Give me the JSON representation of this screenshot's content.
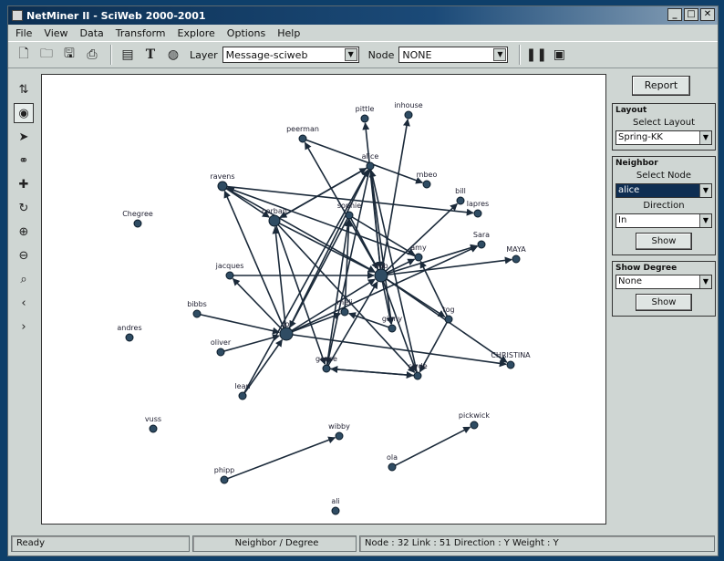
{
  "window": {
    "title": "NetMiner II - SciWeb 2000-2001"
  },
  "window_controls": [
    "_",
    "□",
    "✕"
  ],
  "menu": [
    "File",
    "View",
    "Data",
    "Transform",
    "Explore",
    "Options",
    "Help"
  ],
  "toolbar": {
    "layer_label": "Layer",
    "layer_value": "Message-sciweb",
    "node_label": "Node",
    "node_value": "NONE"
  },
  "right_panel": {
    "report_label": "Report",
    "layout": {
      "title": "Layout",
      "select_label": "Select Layout",
      "value": "Spring-KK"
    },
    "neighbor": {
      "title": "Neighbor",
      "select_node_label": "Select Node",
      "node_value": "alice",
      "direction_label": "Direction",
      "direction_value": "In",
      "show_label": "Show"
    },
    "show_degree": {
      "title": "Show Degree",
      "value": "None",
      "show_label": "Show"
    }
  },
  "status": {
    "ready": "Ready",
    "mode": "Neighbor / Degree",
    "info": "Node : 32   Link : 51   Direction : Y   Weight : Y"
  },
  "graph": {
    "nodes": [
      {
        "id": "pittle",
        "label": "pittle"
      },
      {
        "id": "inhouse",
        "label": "inhouse"
      },
      {
        "id": "peerman",
        "label": "peerman"
      },
      {
        "id": "alice",
        "label": "alice"
      },
      {
        "id": "mbeo",
        "label": "mbeo"
      },
      {
        "id": "ravens",
        "label": "ravens"
      },
      {
        "id": "bill",
        "label": "bill"
      },
      {
        "id": "corban",
        "label": "corban"
      },
      {
        "id": "chegree",
        "label": "Chegree"
      },
      {
        "id": "sophie",
        "label": "sophie"
      },
      {
        "id": "lapres",
        "label": "lapres"
      },
      {
        "id": "sara",
        "label": "Sara"
      },
      {
        "id": "maya",
        "label": "MAYA"
      },
      {
        "id": "amy",
        "label": "amy"
      },
      {
        "id": "hub",
        "label": "hub"
      },
      {
        "id": "jacques",
        "label": "jacques"
      },
      {
        "id": "bibbs",
        "label": "bibbs"
      },
      {
        "id": "andres",
        "label": "andres"
      },
      {
        "id": "meli",
        "label": "meli"
      },
      {
        "id": "ginny",
        "label": "ginny"
      },
      {
        "id": "tog",
        "label": "tog"
      },
      {
        "id": "jo",
        "label": "jo"
      },
      {
        "id": "oliver",
        "label": "oliver"
      },
      {
        "id": "goose",
        "label": "goose"
      },
      {
        "id": "clyde",
        "label": "clyde"
      },
      {
        "id": "lean",
        "label": "lean"
      },
      {
        "id": "christina",
        "label": "CHRISTINA"
      },
      {
        "id": "vuss",
        "label": "vuss"
      },
      {
        "id": "wibby",
        "label": "wibby"
      },
      {
        "id": "pickwick",
        "label": "pickwick"
      },
      {
        "id": "phipp",
        "label": "phipp"
      },
      {
        "id": "ola",
        "label": "ola"
      },
      {
        "id": "ali",
        "label": "ali"
      }
    ]
  }
}
